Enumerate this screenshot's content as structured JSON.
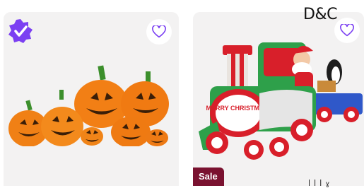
{
  "brand_text": "D&C",
  "corner_text": "ꟾ ꟾ ꟾ ɣ",
  "accent_color": "#7b3ff2",
  "sale_color": "#7a1230",
  "products": [
    {
      "badge_icon": "verified-check-icon",
      "fav_icon": "heart-outline-icon",
      "image": "inflatable-pumpkins"
    },
    {
      "badge_text": "Sale",
      "fav_icon": "heart-outline-icon",
      "image": "inflatable-christmas-train",
      "banner_text": "MERRY CHRISTMAS!"
    }
  ]
}
